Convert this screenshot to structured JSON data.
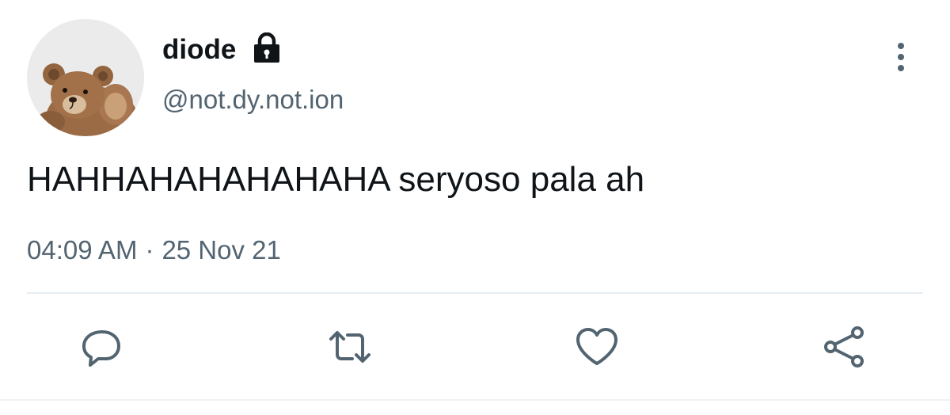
{
  "user": {
    "display_name": "diode",
    "handle": "@not.dy.not.ion",
    "protected": true,
    "avatar": "teddy-bear"
  },
  "tweet": {
    "text": "HAHHAHAHAHAHAHA seryoso pala ah",
    "time": "04:09 AM",
    "separator": "·",
    "date": "25 Nov 21"
  },
  "actions": [
    {
      "name": "reply",
      "icon": "reply-icon"
    },
    {
      "name": "retweet",
      "icon": "retweet-icon"
    },
    {
      "name": "like",
      "icon": "heart-icon"
    },
    {
      "name": "share",
      "icon": "share-icon"
    }
  ],
  "colors": {
    "text_primary": "#0f1419",
    "text_secondary": "#536471",
    "divider": "#e6ecf0"
  }
}
